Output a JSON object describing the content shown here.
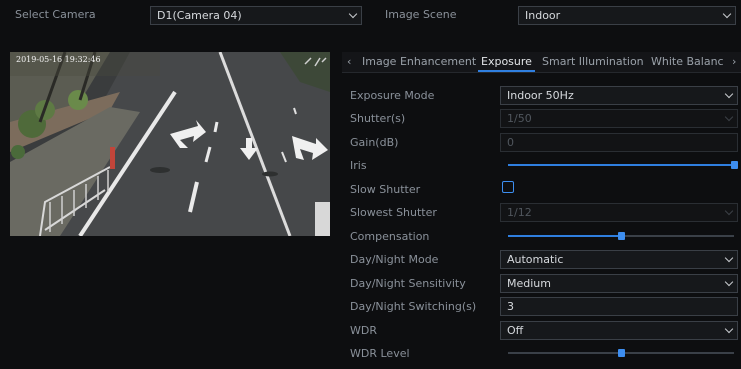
{
  "top": {
    "camera_label": "Select Camera",
    "camera_value": "D1(Camera 04)",
    "scene_label": "Image Scene",
    "scene_value": "Indoor"
  },
  "preview": {
    "timestamp": "2019-05-16 19:32:46"
  },
  "tabs": [
    {
      "label": "Image Enhancement"
    },
    {
      "label": "Exposure"
    },
    {
      "label": "Smart Illumination"
    },
    {
      "label": "White Balanc"
    }
  ],
  "settings": {
    "exposure_mode": {
      "label": "Exposure Mode",
      "value": "Indoor 50Hz"
    },
    "shutter": {
      "label": "Shutter(s)",
      "value": "1/50"
    },
    "gain": {
      "label": "Gain(dB)",
      "value": "0"
    },
    "iris": {
      "label": "Iris",
      "level": 1.0
    },
    "slow_shutter": {
      "label": "Slow Shutter",
      "checked": false
    },
    "slowest_shutter": {
      "label": "Slowest Shutter",
      "value": "1/12"
    },
    "compensation": {
      "label": "Compensation",
      "level": 0.5
    },
    "day_night_mode": {
      "label": "Day/Night Mode",
      "value": "Automatic"
    },
    "day_night_sensitivity": {
      "label": "Day/Night Sensitivity",
      "value": "Medium"
    },
    "day_night_switching": {
      "label": "Day/Night Switching(s)",
      "value": "3"
    },
    "wdr": {
      "label": "WDR",
      "value": "Off"
    },
    "wdr_level": {
      "label": "WDR Level",
      "level": 0.5
    }
  },
  "colors": {
    "accent": "#2f7fe0",
    "background": "#0d0e10"
  }
}
